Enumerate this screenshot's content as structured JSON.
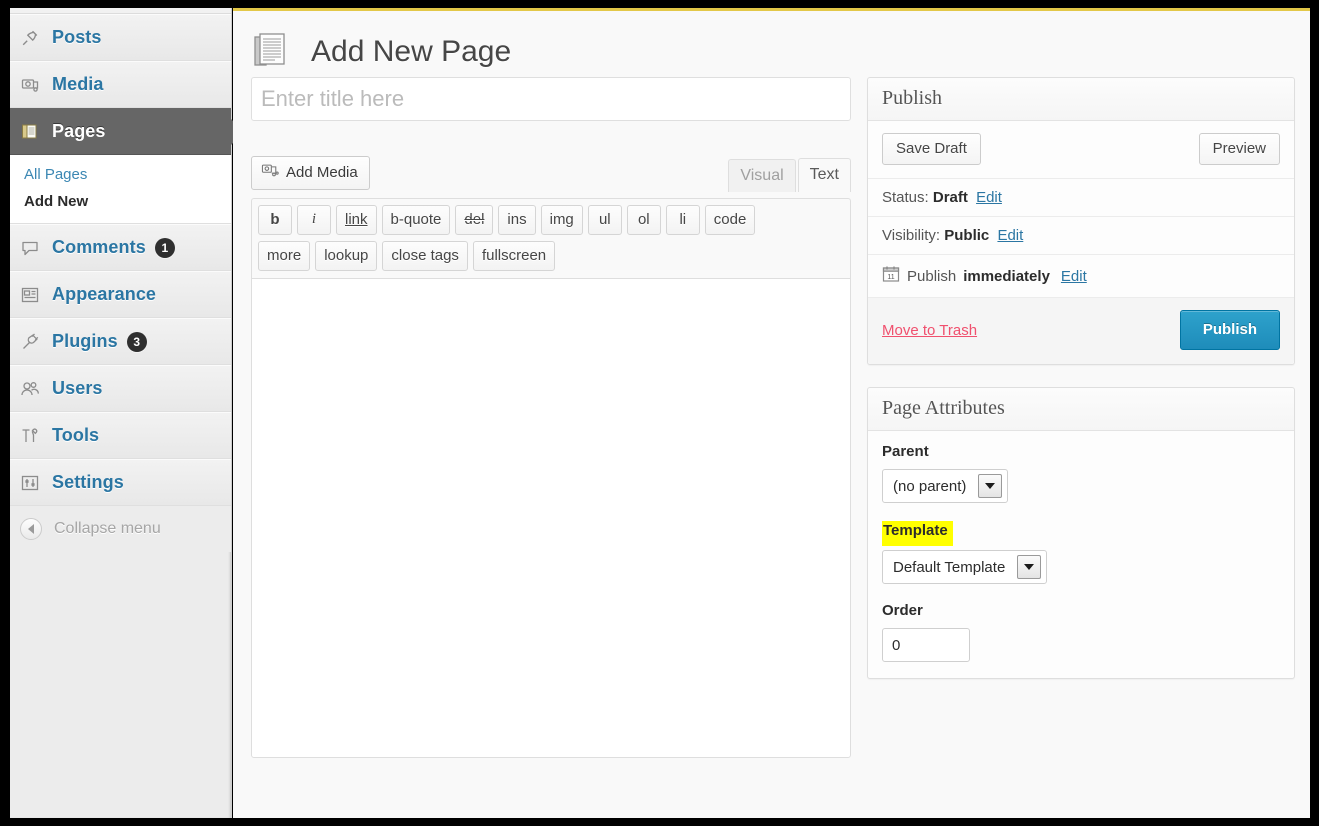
{
  "sidebar": {
    "items": [
      {
        "label": "Posts",
        "icon": "pin-icon",
        "badge": null,
        "current": false
      },
      {
        "label": "Media",
        "icon": "camera-icon",
        "badge": null,
        "current": false
      },
      {
        "label": "Pages",
        "icon": "pages-icon",
        "badge": null,
        "current": true
      },
      {
        "label": "Comments",
        "icon": "comment-icon",
        "badge": "1",
        "current": false
      },
      {
        "label": "Appearance",
        "icon": "appearance-icon",
        "badge": null,
        "current": false
      },
      {
        "label": "Plugins",
        "icon": "plug-icon",
        "badge": "3",
        "current": false
      },
      {
        "label": "Users",
        "icon": "users-icon",
        "badge": null,
        "current": false
      },
      {
        "label": "Tools",
        "icon": "tools-icon",
        "badge": null,
        "current": false
      },
      {
        "label": "Settings",
        "icon": "settings-icon",
        "badge": null,
        "current": false
      }
    ],
    "submenu": [
      {
        "label": "All Pages",
        "current": false
      },
      {
        "label": "Add New",
        "current": true
      }
    ],
    "collapse": {
      "label": "Collapse menu",
      "icon": "collapse-arrow-icon"
    }
  },
  "header": {
    "title": "Add New Page",
    "icon": "page-document-icon"
  },
  "title_field": {
    "placeholder": "Enter title here",
    "value": ""
  },
  "editor": {
    "add_media_label": "Add Media",
    "add_media_icon": "media-camera-icon",
    "tabs": [
      {
        "label": "Visual",
        "active": false
      },
      {
        "label": "Text",
        "active": true
      }
    ],
    "quicktags_row1": [
      "b",
      "i",
      "link",
      "b-quote",
      "del",
      "ins",
      "img",
      "ul",
      "ol",
      "li",
      "code"
    ],
    "quicktags_row2": [
      "more",
      "lookup",
      "close tags",
      "fullscreen"
    ],
    "content": ""
  },
  "publish_box": {
    "title": "Publish",
    "save_draft_label": "Save Draft",
    "preview_label": "Preview",
    "status_label": "Status:",
    "status_value": "Draft",
    "status_edit": "Edit",
    "visibility_label": "Visibility:",
    "visibility_value": "Public",
    "visibility_edit": "Edit",
    "schedule_icon": "calendar-icon",
    "schedule_label": "Publish",
    "schedule_value": "immediately",
    "schedule_edit": "Edit",
    "trash_label": "Move to Trash",
    "publish_label": "Publish"
  },
  "page_attributes": {
    "title": "Page Attributes",
    "parent_label": "Parent",
    "parent_value": "(no parent)",
    "template_label": "Template",
    "template_value": "Default Template",
    "order_label": "Order",
    "order_value": "0"
  },
  "colors": {
    "accent_blue": "#2b76a3",
    "publish_button": "#2ea2cc",
    "trash_red": "#f0506e",
    "highlight_yellow": "#ffff00",
    "top_rule_yellow": "#e3c848",
    "active_menu_gray": "#666666"
  }
}
